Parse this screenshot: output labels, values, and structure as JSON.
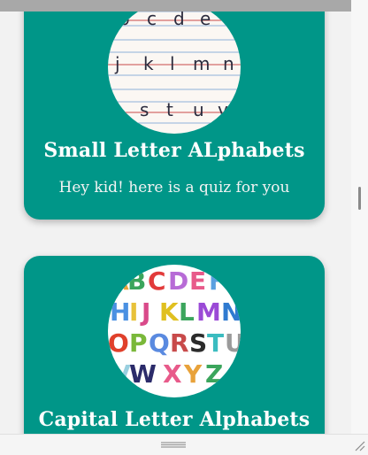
{
  "cards": [
    {
      "title": "Small Letter ALphabets",
      "subtitle": "Hey kid! here is a quiz for you",
      "image_letters": [
        "b",
        "c",
        "d",
        "e",
        "j",
        "k",
        "l",
        "m",
        "n",
        "s",
        "t",
        "u",
        "v"
      ]
    },
    {
      "title": "Capital Letter Alphabets",
      "image_letters": [
        "A",
        "B",
        "C",
        "D",
        "E",
        "F",
        "H",
        "I",
        "J",
        "K",
        "L",
        "M",
        "N",
        "O",
        "P",
        "Q",
        "R",
        "S",
        "T",
        "U",
        "V",
        "W",
        "X",
        "Y",
        "Z"
      ]
    }
  ],
  "colors": {
    "card_background": "#009688",
    "page_background": "#f2f2f2",
    "title_text": "#ffffff"
  },
  "icons": [
    "drag-handle-icon",
    "resize-corner-icon",
    "scrollbar-grip-icon"
  ]
}
